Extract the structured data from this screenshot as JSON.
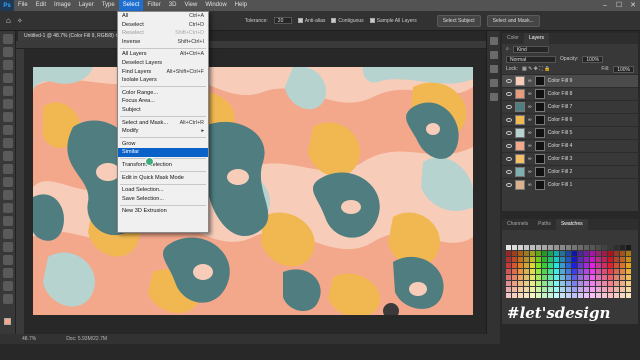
{
  "menubar": {
    "logo": "Ps",
    "items": [
      "File",
      "Edit",
      "Image",
      "Layer",
      "Type",
      "Select",
      "Filter",
      "3D",
      "View",
      "Window",
      "Help"
    ],
    "active_index": 5,
    "win_controls": [
      "–",
      "☐",
      "✕"
    ]
  },
  "options_bar": {
    "tolerance_label": "Tolerance:",
    "tolerance_value": "20",
    "anti_alias": "Anti-alias",
    "contiguous": "Contiguous",
    "sample_all": "Sample All Layers",
    "select_subject": "Select Subject",
    "select_and_mask": "Select and Mask..."
  },
  "document": {
    "tab_title": "Untitled-1 @ 48.7% (Color Fill 9, RGB/8)",
    "zoom": "48.7%",
    "doc_size": "Doc: 5.93M/22.7M"
  },
  "select_menu": {
    "groups": [
      [
        {
          "label": "All",
          "shortcut": "Ctrl+A"
        },
        {
          "label": "Deselect",
          "shortcut": "Ctrl+D"
        },
        {
          "label": "Reselect",
          "shortcut": "Shift+Ctrl+D",
          "disabled": true
        },
        {
          "label": "Inverse",
          "shortcut": "Shift+Ctrl+I"
        }
      ],
      [
        {
          "label": "All Layers",
          "shortcut": "Alt+Ctrl+A"
        },
        {
          "label": "Deselect Layers",
          "shortcut": ""
        },
        {
          "label": "Find Layers",
          "shortcut": "Alt+Shift+Ctrl+F"
        },
        {
          "label": "Isolate Layers",
          "shortcut": ""
        }
      ],
      [
        {
          "label": "Color Range...",
          "shortcut": ""
        },
        {
          "label": "Focus Area...",
          "shortcut": ""
        },
        {
          "label": "Subject",
          "shortcut": ""
        }
      ],
      [
        {
          "label": "Select and Mask...",
          "shortcut": "Alt+Ctrl+R"
        },
        {
          "label": "Modify",
          "shortcut": "▸"
        }
      ],
      [
        {
          "label": "Grow",
          "shortcut": ""
        },
        {
          "label": "Similar",
          "shortcut": "",
          "highlighted": true
        }
      ],
      [
        {
          "label": "Transform Selection",
          "shortcut": ""
        }
      ],
      [
        {
          "label": "Edit in Quick Mask Mode",
          "shortcut": ""
        }
      ],
      [
        {
          "label": "Load Selection...",
          "shortcut": ""
        },
        {
          "label": "Save Selection...",
          "shortcut": ""
        }
      ],
      [
        {
          "label": "New 3D Extrusion",
          "shortcut": ""
        }
      ]
    ]
  },
  "layers_panel": {
    "tabs": [
      "Color",
      "Layers"
    ],
    "active_tab": "Layers",
    "kind": "Kind",
    "blend_mode": "Normal",
    "opacity_label": "Opacity:",
    "opacity": "100%",
    "lock_label": "Lock:",
    "fill_label": "Fill:",
    "fill": "100%",
    "layers": [
      {
        "name": "Color Fill 9",
        "color": "#f7cdb9",
        "selected": true
      },
      {
        "name": "Color Fill 8",
        "color": "#e89a7d"
      },
      {
        "name": "Color Fill 7",
        "color": "#4f7d80"
      },
      {
        "name": "Color Fill 6",
        "color": "#f1b852"
      },
      {
        "name": "Color Fill 5",
        "color": "#b7d3cf"
      },
      {
        "name": "Color Fill 4",
        "color": "#f3a78b"
      },
      {
        "name": "Color Fill 3",
        "color": "#f3c069"
      },
      {
        "name": "Color Fill 2",
        "color": "#7fb0b0"
      },
      {
        "name": "Color Fill 1",
        "color": "#d9b28d"
      }
    ]
  },
  "swatches_panel": {
    "tabs": [
      "Channels",
      "Paths",
      "Swatches"
    ],
    "active_tab": "Swatches"
  },
  "watermark": "#let'sdesign",
  "palette": {
    "peach": "#f7cdb9",
    "salmon": "#f3a78b",
    "mustard": "#f1b852",
    "mint": "#b7d3cf",
    "teal": "#4f7d80",
    "accent": "#0a62c9"
  }
}
